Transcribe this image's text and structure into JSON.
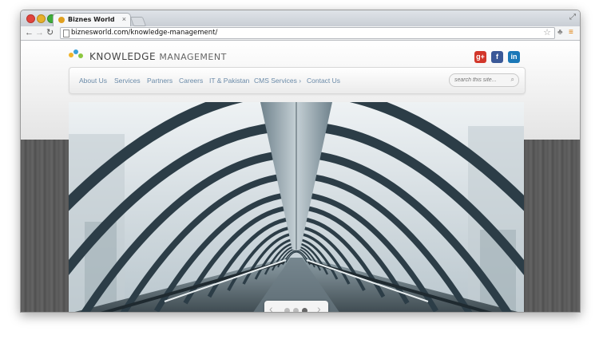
{
  "browser": {
    "tab_title": "Biznes World",
    "url": "biznesworld.com/knowledge-management/",
    "tab_close_glyph": "×",
    "icons": [
      "back-arrow-icon",
      "forward-arrow-icon",
      "reload-icon",
      "page-icon",
      "star-icon",
      "extension-icon",
      "menu-icon"
    ]
  },
  "site": {
    "logo_word1": "KNOWLEDGE",
    "logo_word2": "MANAGEMENT",
    "logo_dot_colors": [
      "#f0b429",
      "#3aa0d8",
      "#8cc63f"
    ],
    "social": {
      "googleplus": "g+",
      "facebook": "f",
      "linkedin": "in"
    },
    "nav": [
      {
        "label": "About Us"
      },
      {
        "label": "Services"
      },
      {
        "label": "Partners"
      },
      {
        "label": "Careers"
      },
      {
        "label": "IT & Pakistan"
      },
      {
        "label": "CMS Services ›"
      },
      {
        "label": "Contact Us"
      }
    ],
    "search_placeholder": "search this site..."
  },
  "slider": {
    "prev": "‹",
    "next": "›",
    "dots": 3,
    "active_dot": 3
  },
  "colors": {
    "nav_link": "#6a8aa8",
    "googleplus": "#d2372b",
    "facebook": "#3b5998",
    "linkedin": "#1b78b8"
  }
}
